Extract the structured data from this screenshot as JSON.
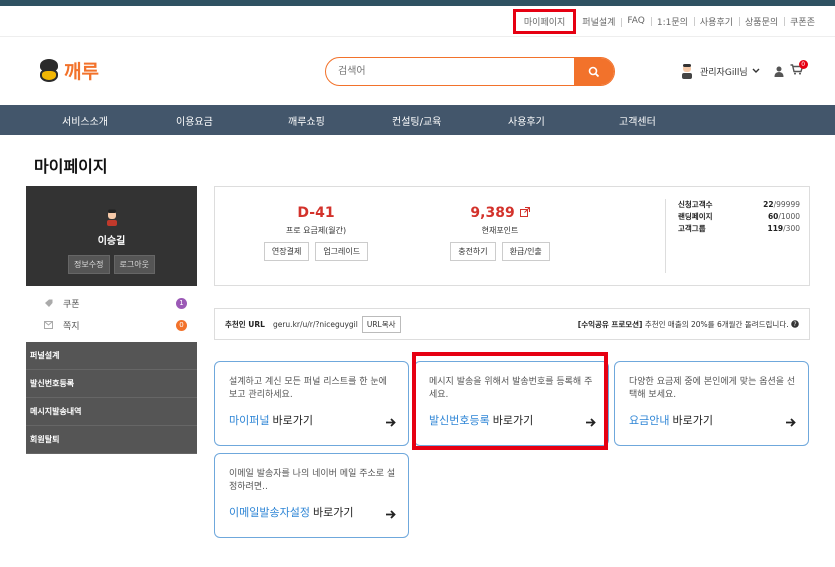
{
  "utility_nav": [
    "마이페이지",
    "퍼널설계",
    "FAQ",
    "1:1문의",
    "사용후기",
    "상품문의",
    "쿠폰존"
  ],
  "logo": {
    "text": "깨루"
  },
  "search": {
    "placeholder": "검색어"
  },
  "user": {
    "name": "관리자Gill님"
  },
  "cart": {
    "count": "0"
  },
  "main_nav": [
    "서비스소개",
    "이용요금",
    "깨루쇼핑",
    "컨설팅/교육",
    "사용후기",
    "고객센터"
  ],
  "page_title": "마이페이지",
  "profile": {
    "name": "이승길",
    "edit_label": "정보수정",
    "logout_label": "로그아웃"
  },
  "sidebar_counts": [
    {
      "label": "쿠폰",
      "count": "1",
      "color": "#9b59b6"
    },
    {
      "label": "쪽지",
      "count": "0",
      "color": "#f2722b"
    }
  ],
  "sidebar_menu": [
    "퍼널설계",
    "발신번호등록",
    "메시지발송내역",
    "회원탈퇴"
  ],
  "plan": {
    "dday": "D-41",
    "name": "프로 요금제(월간)",
    "btn1": "연장결제",
    "btn2": "업그레이드"
  },
  "points": {
    "value": "9,389",
    "label": "현재포인트",
    "btn1": "충전하기",
    "btn2": "환급/인출"
  },
  "limits": [
    {
      "label": "신청고객수",
      "value": "22",
      "max": "/99999"
    },
    {
      "label": "랜딩페이지",
      "value": "60",
      "max": "/1000"
    },
    {
      "label": "고객그룹",
      "value": "119",
      "max": "/300"
    }
  ],
  "referral": {
    "label": "추천인 URL",
    "url": "geru.kr/u/r/?niceguygil",
    "copy_label": "URL복사",
    "note_bold": "[수익공유 프로모션]",
    "note_text": " 추천인 매출의 20%를 6개월간 돌려드립니다."
  },
  "cards": [
    {
      "desc": "설계하고 계신 모든 퍼널 리스트를 한 눈에 보고 관리하세요.",
      "link": "마이퍼널",
      "suffix": "바로가기"
    },
    {
      "desc": "메시지 발송을 위해서 발송번호를 등록해 주세요.",
      "link": "발신번호등록",
      "suffix": "바로가기"
    },
    {
      "desc": "다양한 요금제 중에 본인에게 맞는 옵션을 선택해 보세요.",
      "link": "요금안내",
      "suffix": "바로가기"
    },
    {
      "desc": "이메일 발송자를 나의 네이버 메일 주소로 설정하려면..",
      "link": "이메일발송자설정",
      "suffix": "바로가기"
    }
  ],
  "colors": {
    "accent": "#f2722b",
    "nav_bg": "#43566b",
    "highlight": "#e60012",
    "link_blue": "#2f86d6",
    "dday_red": "#d3322b"
  }
}
